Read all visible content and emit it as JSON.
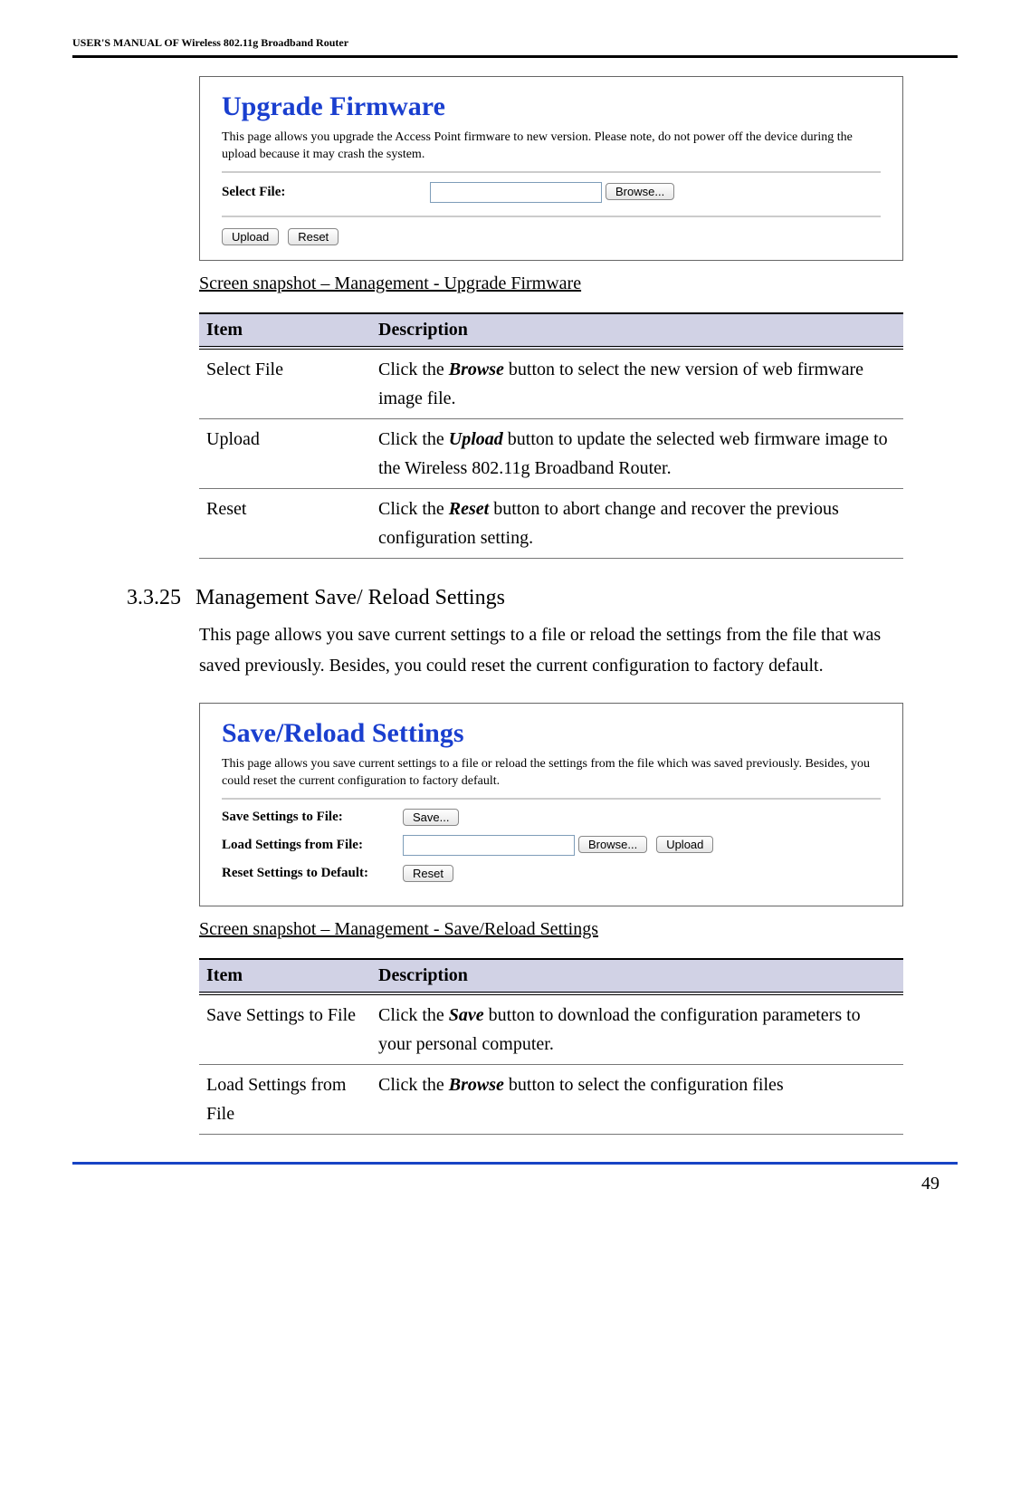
{
  "header": "USER'S MANUAL OF Wireless 802.11g Broadband Router",
  "upgrade_panel": {
    "title": "Upgrade Firmware",
    "desc": "This page allows you upgrade the Access Point firmware to new version. Please note, do not power off the device during the upload because it may crash the system.",
    "select_file_label": "Select File:",
    "browse_btn": "Browse...",
    "upload_btn": "Upload",
    "reset_btn": "Reset"
  },
  "upgrade_caption": "Screen snapshot – Management - Upgrade Firmware",
  "table_headers": {
    "item": "Item",
    "desc": "Description"
  },
  "upgrade_table": [
    {
      "item": "Select File",
      "desc_pre": "Click the ",
      "bold": "Browse",
      "desc_post": " button to select the new version of web firmware image file."
    },
    {
      "item": "Upload",
      "desc_pre": "Click the ",
      "bold": "Upload",
      "desc_post": " button to update the selected web firmware image to the Wireless 802.11g Broadband Router."
    },
    {
      "item": "Reset",
      "desc_pre": "Click the ",
      "bold": "Reset",
      "desc_post": " button to abort change and recover the previous configuration setting."
    }
  ],
  "section": {
    "number": "3.3.25",
    "title": "Management Save/ Reload Settings",
    "body": "This page allows you save current settings to a file or reload the settings from the file that was saved previously. Besides, you could reset the current configuration to factory default."
  },
  "save_panel": {
    "title": "Save/Reload Settings",
    "desc": "This page allows you save current settings to a file or reload the settings from the file which was saved previously. Besides, you could reset the current configuration to factory default.",
    "save_label": "Save Settings to File:",
    "save_btn": "Save...",
    "load_label": "Load Settings from File:",
    "browse_btn": "Browse...",
    "upload_btn": "Upload",
    "reset_label": "Reset Settings to Default:",
    "reset_btn": "Reset"
  },
  "save_caption": "Screen snapshot – Management - Save/Reload Settings",
  "save_table": [
    {
      "item": "Save Settings to File",
      "desc_pre": "Click the ",
      "bold": "Save",
      "desc_post": " button to download the configuration parameters to your personal computer."
    },
    {
      "item": "Load Settings from File",
      "desc_pre": "Click the ",
      "bold": "Browse",
      "desc_post": " button to select the configuration files"
    }
  ],
  "page_number": "49"
}
